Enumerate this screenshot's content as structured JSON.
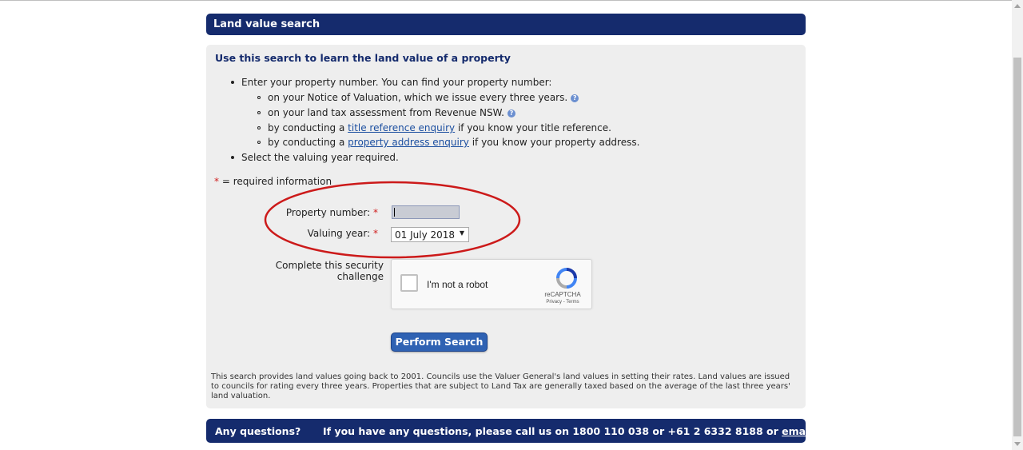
{
  "header": {
    "title": "Land value search"
  },
  "panel": {
    "heading": "Use this search to learn the land value of a property",
    "instructions": {
      "item1": "Enter your property number. You can find your property number:",
      "sub1": "on your Notice of Valuation, which we issue every three years.",
      "sub2": "on your land tax assessment from Revenue NSW.",
      "sub3_prefix": "by conducting a",
      "sub3_link": "title reference enquiry",
      "sub3_suffix": "if you know your title reference.",
      "sub4_prefix": "by conducting a",
      "sub4_link": "property address enquiry",
      "sub4_suffix": "if you know your property address.",
      "item2": "Select the valuing year required."
    },
    "required_star": "*",
    "required_note": "= required information",
    "form": {
      "property_label": "Property number:",
      "property_value": "",
      "year_label": "Valuing year:",
      "year_value": "01 July 2018",
      "security_label": "Complete this security challenge"
    },
    "recaptcha": {
      "label": "I'm not a robot",
      "brand": "reCAPTCHA",
      "terms": "Privacy - Terms"
    },
    "search_button": "Perform Search",
    "footnote": "This search provides land values going back to 2001. Councils use the Valuer General's land values in setting their rates. Land values are issued to councils for rating every three years. Properties that are subject to Land Tax are generally taxed based on the average of the last three years' land valuation."
  },
  "footer": {
    "question": "Any questions?",
    "message_prefix": "If you have any questions, please call us on 1800 110 038 or +61 2 6332 8188 or",
    "email_link": "email us",
    "message_suffix": "."
  },
  "colors": {
    "navy": "#152b6d",
    "panel_bg": "#eeeeee",
    "link": "#1c4fa0",
    "button": "#2f62b3",
    "annotation_red": "#cc1a1a"
  }
}
